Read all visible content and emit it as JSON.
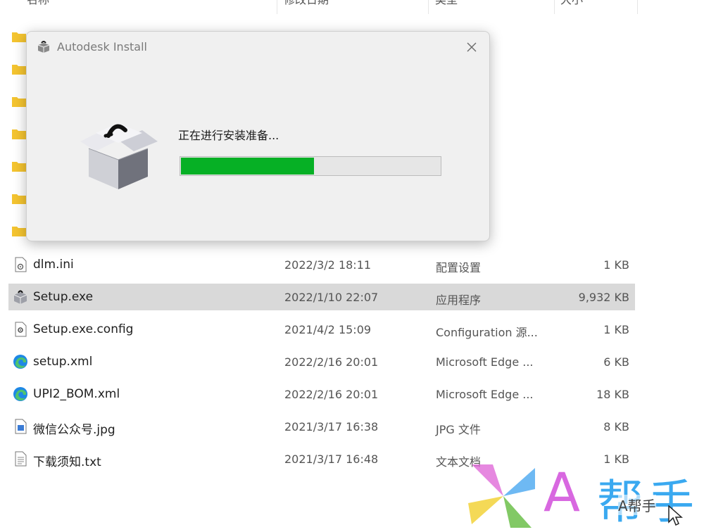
{
  "explorer": {
    "columns": {
      "name": "名称",
      "date": "修改日期",
      "type": "类型",
      "size": "大小"
    },
    "files": [
      {
        "name": "dlm.ini",
        "date": "2022/3/2 18:11",
        "type": "配置设置",
        "size": "1 KB",
        "icon": "ini-file-icon"
      },
      {
        "name": "Setup.exe",
        "date": "2022/1/10 22:07",
        "type": "应用程序",
        "size": "9,932 KB",
        "icon": "installer-box-icon",
        "selected": true
      },
      {
        "name": "Setup.exe.config",
        "date": "2021/4/2 15:09",
        "type": "Configuration 源...",
        "size": "1 KB",
        "icon": "config-file-icon"
      },
      {
        "name": "setup.xml",
        "date": "2022/2/16 20:01",
        "type": "Microsoft Edge ...",
        "size": "6 KB",
        "icon": "edge-icon"
      },
      {
        "name": "UPI2_BOM.xml",
        "date": "2022/2/16 20:01",
        "type": "Microsoft Edge ...",
        "size": "18 KB",
        "icon": "edge-icon"
      },
      {
        "name": "微信公众号.jpg",
        "date": "2021/3/17 16:38",
        "type": "JPG 文件",
        "size": "8 KB",
        "icon": "image-file-icon"
      },
      {
        "name": "下载须知.txt",
        "date": "2021/3/17 16:48",
        "type": "文本文档",
        "size": "1 KB",
        "icon": "text-file-icon"
      }
    ]
  },
  "dialog": {
    "title": "Autodesk Install",
    "status": "正在进行安装准备...",
    "progress_fraction": 0.51
  },
  "watermark": {
    "letter": "A",
    "cn": "帮手",
    "small": "A帮手"
  },
  "colors": {
    "progress": "#06b025",
    "selection": "#d9d9d9",
    "folder": "#f4c430"
  }
}
